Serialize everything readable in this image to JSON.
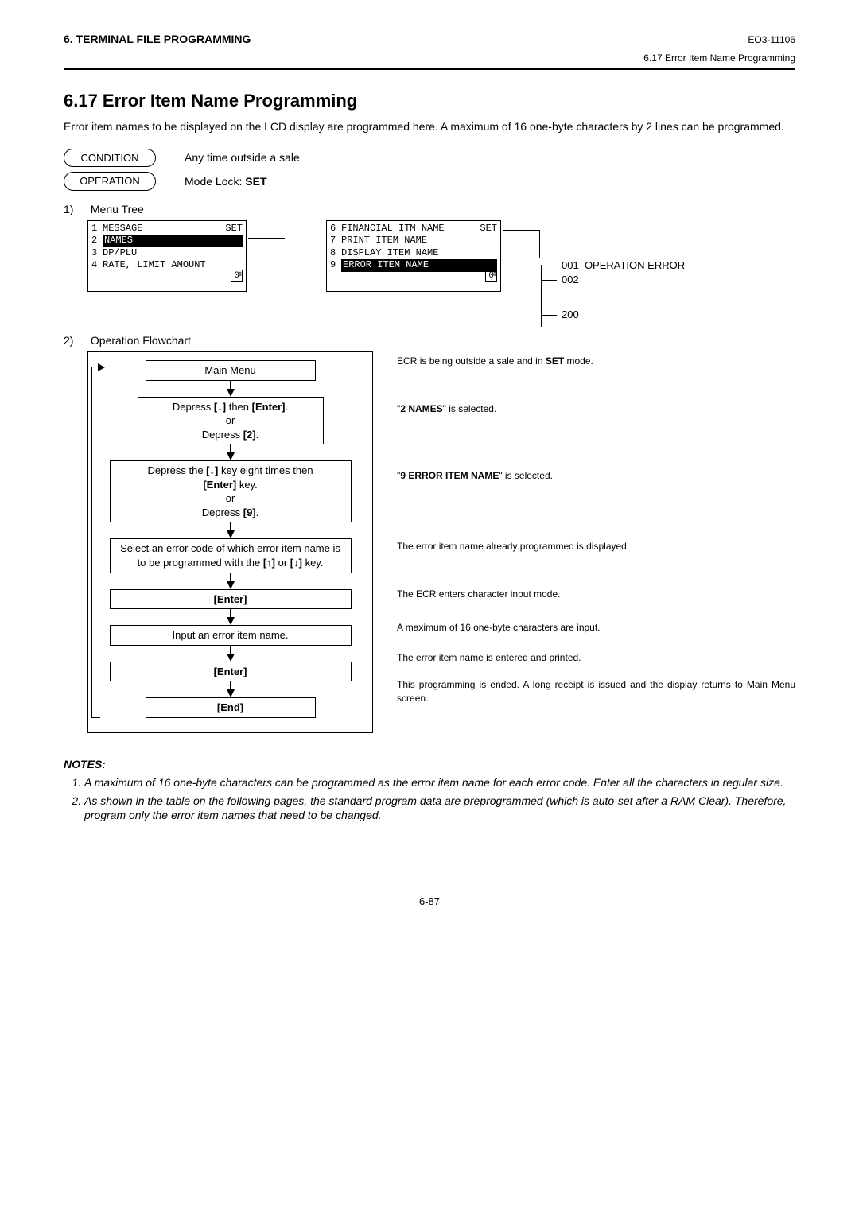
{
  "header": {
    "chapter": "6. TERMINAL FILE PROGRAMMING",
    "doc_id": "EO3-11106",
    "breadcrumb": "6.17 Error Item Name Programming"
  },
  "title": "6.17   Error Item Name Programming",
  "intro": "Error item names to be displayed on the LCD display are programmed here.  A maximum of 16 one-byte characters by 2 lines can be programmed.",
  "condition_label": "CONDITION",
  "condition_text": "Any time outside a sale",
  "operation_label": "OPERATION",
  "operation_text_prefix": "Mode Lock: ",
  "operation_text_bold": "SET",
  "sec1_num": "1)",
  "sec1_title": "Menu Tree",
  "menu1": {
    "top_right": "SET",
    "rows": [
      {
        "n": "1",
        "l": "MESSAGE"
      },
      {
        "n": "2",
        "l": "NAMES",
        "sel": true
      },
      {
        "n": "3",
        "l": "DP/PLU"
      },
      {
        "n": "4",
        "l": "RATE, LIMIT AMOUNT"
      }
    ],
    "bot_num": "0",
    "scroll": "⇕"
  },
  "menu2": {
    "top_right": "SET",
    "rows": [
      {
        "n": "6",
        "l": "FINANCIAL ITM NAME"
      },
      {
        "n": "7",
        "l": "PRINT ITEM NAME"
      },
      {
        "n": "8",
        "l": "DISPLAY ITEM NAME"
      },
      {
        "n": "9",
        "l": "ERROR ITEM NAME",
        "sel": true
      }
    ],
    "bot_num": "0",
    "scroll": "⇕"
  },
  "side": {
    "a": "001",
    "a_lbl": "OPERATION ERROR",
    "b": "002",
    "c": "200"
  },
  "sec2_num": "2)",
  "sec2_title": "Operation Flowchart",
  "flow": {
    "b1": "Main Menu",
    "b2a": "Depress ",
    "b2b": "[↓]",
    "b2c": " then ",
    "b2d": "[Enter]",
    "b2e": ".",
    "b2_or": "or",
    "b2f": "Depress ",
    "b2g": "[2]",
    "b2h": ".",
    "b3a": "Depress the ",
    "b3b": "[↓]",
    "b3c": " key eight times then",
    "b3d": "[Enter]",
    "b3e": " key.",
    "b3_or": "or",
    "b3f": "Depress ",
    "b3g": "[9]",
    "b3h": ".",
    "b4a": "Select an error code of which error item name is to be programmed with the ",
    "b4b": "[↑]",
    "b4c": " or ",
    "b4d": "[↓]",
    "b4e": " key.",
    "b5": "[Enter]",
    "b6": "Input an error item name.",
    "b7": "[Enter]",
    "b8": "[End]"
  },
  "desc": {
    "d1a": "ECR is being outside a sale and in ",
    "d1b": "SET",
    "d1c": " mode.",
    "d2a": "\"",
    "d2b": "2 NAMES",
    "d2c": "\" is selected.",
    "d3a": "\"",
    "d3b": "9 ERROR ITEM NAME",
    "d3c": "\" is selected.",
    "d4": "The error item name already programmed is displayed.",
    "d5": "The ECR enters character input mode.",
    "d6": "A maximum of 16 one-byte characters are input.",
    "d7": "The error item name is entered and printed.",
    "d8": "This programming is ended.  A long receipt is issued and the display returns to Main Menu screen."
  },
  "notes_title": "NOTES:",
  "note1": "A maximum of 16 one-byte characters can be programmed as the error item name for each error code.  Enter all the characters in regular size.",
  "note2": "As shown in the table on the following pages, the standard program data are preprogrammed (which is auto-set after a RAM Clear). Therefore, program only the error item names that need to be changed.",
  "page_no": "6-87"
}
